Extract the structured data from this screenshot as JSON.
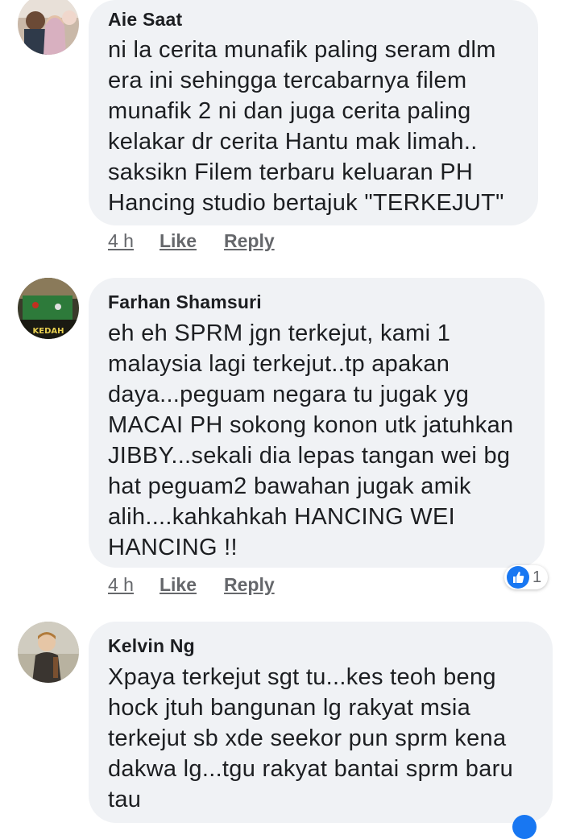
{
  "comments": [
    {
      "author": "Aie Saat",
      "text": "ni la cerita munafik paling seram dlm\nera ini sehingga tercabarnya filem\nmunafik 2 ni dan juga cerita paling\nkelakar dr cerita Hantu mak limah..\nsaksikn Filem terbaru keluaran PH\nHancing studio bertajuk \"TERKEJUT\"",
      "time": "4 h",
      "like_label": "Like",
      "reply_label": "Reply",
      "avatar_icon": "couple-photo-avatar"
    },
    {
      "author": "Farhan Shamsuri",
      "text": "eh eh SPRM jgn terkejut, kami 1\nmalaysia lagi terkejut..tp apakan\ndaya...peguam negara tu jugak yg\nMACAI PH sokong konon utk jatuhkan\nJIBBY...sekali dia lepas tangan wei bg\nhat peguam2 bawahan jugak amik\nalih....kahkahkah HANCING WEI\nHANCING !!",
      "time": "4 h",
      "like_label": "Like",
      "reply_label": "Reply",
      "avatar_icon": "snooker-table-avatar",
      "avatar_text": "KEDAH",
      "reaction_count": "1",
      "reaction_icon": "like-thumb-icon"
    },
    {
      "author": "Kelvin Ng",
      "text": "Xpaya terkejut sgt tu...kes teoh beng\nhock jtuh bangunan lg rakyat msia\nterkejut sb xde seekor pun sprm kena\ndakwa lg...tgu rakyat bantai sprm baru\ntau",
      "avatar_icon": "man-portrait-avatar"
    }
  ],
  "colors": {
    "bubble": "#f0f2f5",
    "meta": "#65676b",
    "like_blue": "#1877f2"
  }
}
